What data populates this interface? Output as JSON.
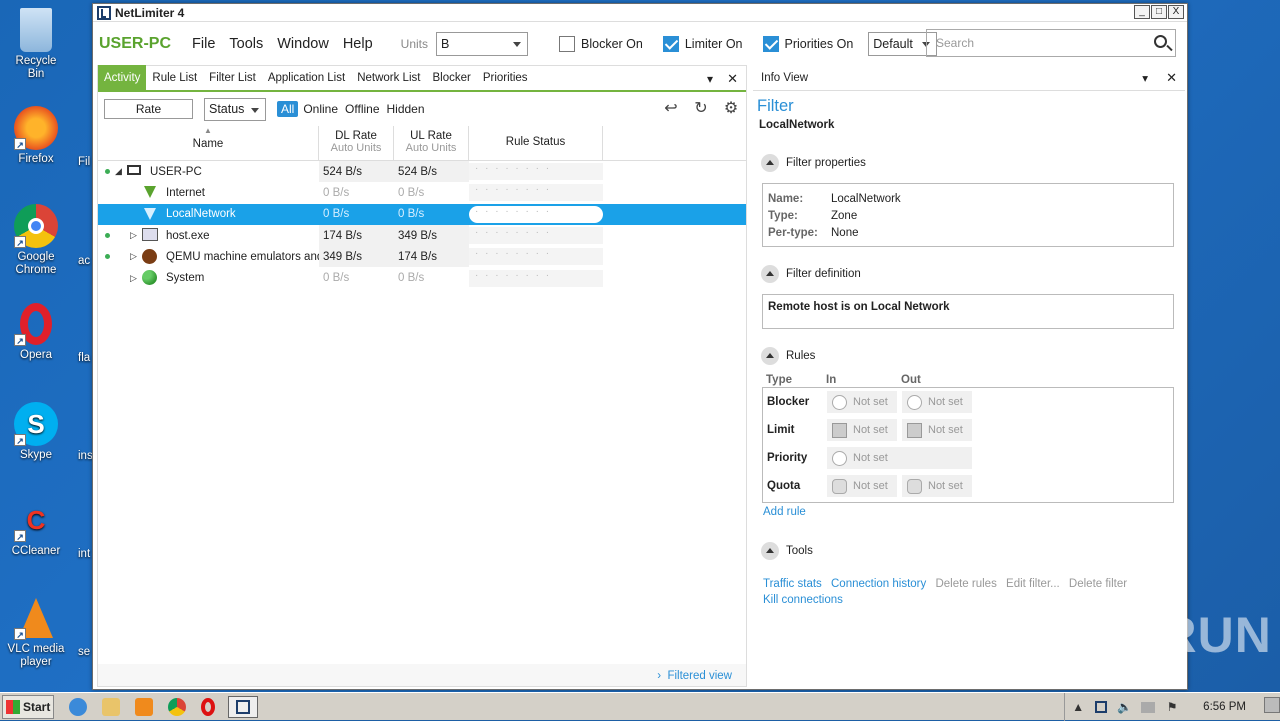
{
  "window": {
    "title": "NetLimiter 4",
    "min": "_",
    "max": "□",
    "close": "X"
  },
  "menubar": {
    "pc_name": "USER-PC",
    "items": [
      "File",
      "Tools",
      "Window",
      "Help"
    ],
    "units_label": "Units",
    "units_value": "B",
    "blocker": "Blocker On",
    "limiter": "Limiter On",
    "priorities": "Priorities On",
    "profile": "Default",
    "search_placeholder": "Search"
  },
  "tabs": [
    "Activity",
    "Rule List",
    "Filter List",
    "Application List",
    "Network List",
    "Blocker",
    "Priorities"
  ],
  "filterbar": {
    "rate": "Rate",
    "status": "Status",
    "all": "All",
    "online": "Online",
    "offline": "Offline",
    "hidden": "Hidden"
  },
  "columns": {
    "name": "Name",
    "dl": "DL Rate",
    "dl_sub": "Auto Units",
    "ul": "UL Rate",
    "ul_sub": "Auto Units",
    "rule": "Rule Status"
  },
  "rows": [
    {
      "name": "USER-PC",
      "dl": "524 B/s",
      "ul": "524 B/s"
    },
    {
      "name": "Internet",
      "dl": "0 B/s",
      "ul": "0 B/s"
    },
    {
      "name": "LocalNetwork",
      "dl": "0 B/s",
      "ul": "0 B/s"
    },
    {
      "name": "host.exe",
      "dl": "174 B/s",
      "ul": "349 B/s"
    },
    {
      "name": "QEMU machine emulators and",
      "dl": "349 B/s",
      "ul": "174 B/s"
    },
    {
      "name": "System",
      "dl": "0 B/s",
      "ul": "0 B/s"
    }
  ],
  "footer": {
    "filtered_view": "Filtered view"
  },
  "info": {
    "header": "Info View",
    "title": "Filter",
    "subtitle": "LocalNetwork",
    "props_section": "Filter properties",
    "props": [
      {
        "k": "Name:",
        "v": "LocalNetwork"
      },
      {
        "k": "Type:",
        "v": "Zone"
      },
      {
        "k": "Per-type:",
        "v": "None"
      }
    ],
    "def_section": "Filter definition",
    "definition": "Remote host is on Local Network",
    "rules_section": "Rules",
    "rules_hdr": {
      "type": "Type",
      "in": "In",
      "out": "Out"
    },
    "rules": [
      {
        "label": "Blocker",
        "in": "Not set",
        "out": "Not set"
      },
      {
        "label": "Limit",
        "in": "Not set",
        "out": "Not set"
      },
      {
        "label": "Priority",
        "in": "Not set"
      },
      {
        "label": "Quota",
        "in": "Not set",
        "out": "Not set"
      }
    ],
    "add_rule": "Add rule",
    "tools_section": "Tools",
    "tools": {
      "traffic_stats": "Traffic stats",
      "conn_history": "Connection history",
      "delete_rules": "Delete rules",
      "edit_filter": "Edit filter...",
      "delete_filter": "Delete filter",
      "kill": "Kill connections"
    }
  },
  "desktop": {
    "icons": [
      "Recycle Bin",
      "Firefox",
      "Google Chrome",
      "Opera",
      "Skype",
      "CCleaner",
      "VLC media player"
    ],
    "peek": [
      "Fil",
      "ac",
      "fla",
      "ins",
      "int",
      "se"
    ]
  },
  "watermark": "ANY RUN",
  "taskbar": {
    "start": "Start",
    "time": "6:56 PM"
  }
}
